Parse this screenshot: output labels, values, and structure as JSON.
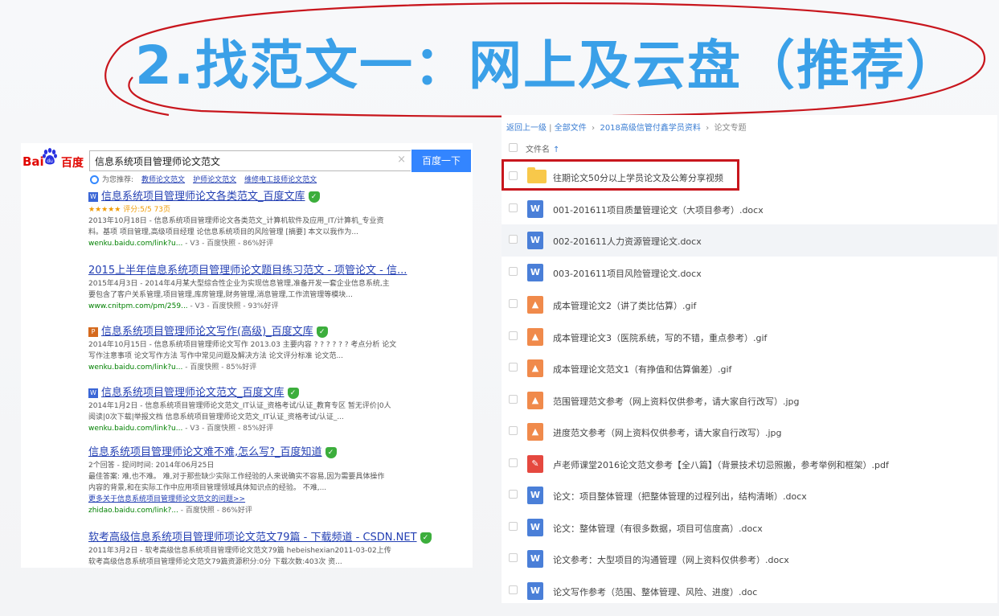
{
  "slide": {
    "title": "2.找范文一：网上及云盘（推荐）",
    "colors": {
      "title": "#3aa0e8",
      "annotation": "#c8161d",
      "baidu_red": "#e10601",
      "link": "#2440b3"
    }
  },
  "baidu": {
    "logo_left": "Bai",
    "logo_paw": "du",
    "logo_right": "百度",
    "query": "信息系统项目管理师论文范文",
    "clear_icon": "×",
    "search_button": "百度一下",
    "recommend_label": "为您推荐:",
    "recommend_links": [
      "教师论文范文",
      "护师论文范文",
      "维修电工技师论文范文"
    ],
    "results": [
      {
        "badge": "W",
        "title": "信息系统项目管理师论文各类范文_百度文库",
        "rating": "★★★★★ 评分:5/5 73页",
        "desc1": "2013年10月18日 - 信息系统项目管理师论文各类范文_计算机软件及应用_IT/计算机_专业资",
        "desc2": "料。基项 项目管理,高级项目经理 论信息系统项目的风险管理 [摘要] 本文以我作为...",
        "url": "wenku.baidu.com/link?u...",
        "meta": "- V3 - 百度快照 - 86%好评"
      },
      {
        "badge": "",
        "title": "2015上半年信息系统项目管理师论文题目练习范文 - 项管论文 - 信...",
        "rating": "",
        "desc1": "2015年4月3日 - 2014年4月某大型综合性企业为实现信息管理,准备开发一套企业信息系统,主",
        "desc2": "要包含了客户关系管理,项目管理,库房管理,财务管理,消息管理,工作流管理等模块...",
        "url": "www.cnitpm.com/pm/259...",
        "meta": "- V3 - 百度快照 - 93%好评"
      },
      {
        "badge": "P",
        "title": "信息系统项目管理师论文写作(高级)_百度文库",
        "rating": "",
        "desc1": "2014年10月15日 - 信息系统项目管理师论文写作 2013.03 主要内容 ? ? ? ? ? ? 考点分析 论文",
        "desc2": "写作注意事项 论文写作方法 写作中常见问题及解决方法 论文评分标准 论文范...",
        "url": "wenku.baidu.com/link?u...",
        "meta": "- 百度快照 - 85%好评"
      },
      {
        "badge": "W",
        "title": "信息系统项目管理师论文范文_百度文库",
        "rating": "",
        "desc1": "2014年1月2日 - 信息系统项目管理师论文范文_IT认证_资格考试/认证_教育专区 暂无评价|0人",
        "desc2": "阅读|0次下载|举报文档 信息系统项目管理师论文范文_IT认证_资格考试/认证_...",
        "url": "wenku.baidu.com/link?u...",
        "meta": "- V3 - 百度快照 - 85%好评"
      },
      {
        "badge": "",
        "title": "信息系统项目管理师论文难不难,怎么写?_百度知道",
        "rating": "2个回答 - 提问时间: 2014年06月25日",
        "desc1": "最佳答案: 难,也不难。 难,对于那些缺少实际工作经验的人来说确实不容易,因为需要具体操作",
        "desc2": "内容的背景,和在实际工作中应用项目管理领域具体知识点的经验。 不难,...",
        "more": "更多关于信息系统项目管理师论文范文的问题>>",
        "url": "zhidao.baidu.com/link?...",
        "meta": "- 百度快照 - 86%好评"
      },
      {
        "badge": "",
        "title": "软考高级信息系统项目管理师项论文范文79篇 - 下载频道 - CSDN.NET",
        "rating": "",
        "desc1": "2011年3月2日 - 软考高级信息系统项目管理师论文范文79篇 hebeishexian2011-03-02上传",
        "desc2": "软考高级信息系统项目管理师论文范文79篇资源积分:0分 下载次数:403次 资...",
        "url": "",
        "meta": ""
      }
    ]
  },
  "disk": {
    "breadcrumb": [
      "返回上一级",
      "全部文件",
      "2018高级信管付鑫学员资料",
      "论文专题"
    ],
    "column_header": "文件名",
    "sort_icon": "↑",
    "files": [
      {
        "type": "folder",
        "name": "往期论文50分以上学员论文及公筹分享视频"
      },
      {
        "type": "docx",
        "name": "001-201611项目质量管理论文（大项目参考）.docx"
      },
      {
        "type": "docx",
        "name": "002-201611人力资源管理论文.docx"
      },
      {
        "type": "docx",
        "name": "003-201611项目风险管理论文.docx"
      },
      {
        "type": "img",
        "name": "成本管理论文2（讲了类比估算）.gif"
      },
      {
        "type": "img",
        "name": "成本管理论文3（医院系统，写的不错，重点参考）.gif"
      },
      {
        "type": "img",
        "name": "成本管理论文范文1（有挣值和估算偏差）.gif"
      },
      {
        "type": "img",
        "name": "范围管理范文参考（网上资料仅供参考，请大家自行改写）.jpg"
      },
      {
        "type": "img",
        "name": "进度范文参考（网上资料仅供参考，请大家自行改写）.jpg"
      },
      {
        "type": "pdf",
        "name": "卢老师课堂2016论文范文参考【全八篇】（背景技术切忌照搬，参考举例和框架）.pdf"
      },
      {
        "type": "docx",
        "name": "论文：项目整体管理（把整体管理的过程列出，结构清晰）.docx"
      },
      {
        "type": "docx",
        "name": "论文：整体管理（有很多数据，项目可信度高）.docx"
      },
      {
        "type": "docx",
        "name": "论文参考：大型项目的沟通管理（网上资料仅供参考）.docx"
      },
      {
        "type": "docx",
        "name": "论文写作参考（范围、整体管理、风险、进度）.doc"
      }
    ]
  }
}
